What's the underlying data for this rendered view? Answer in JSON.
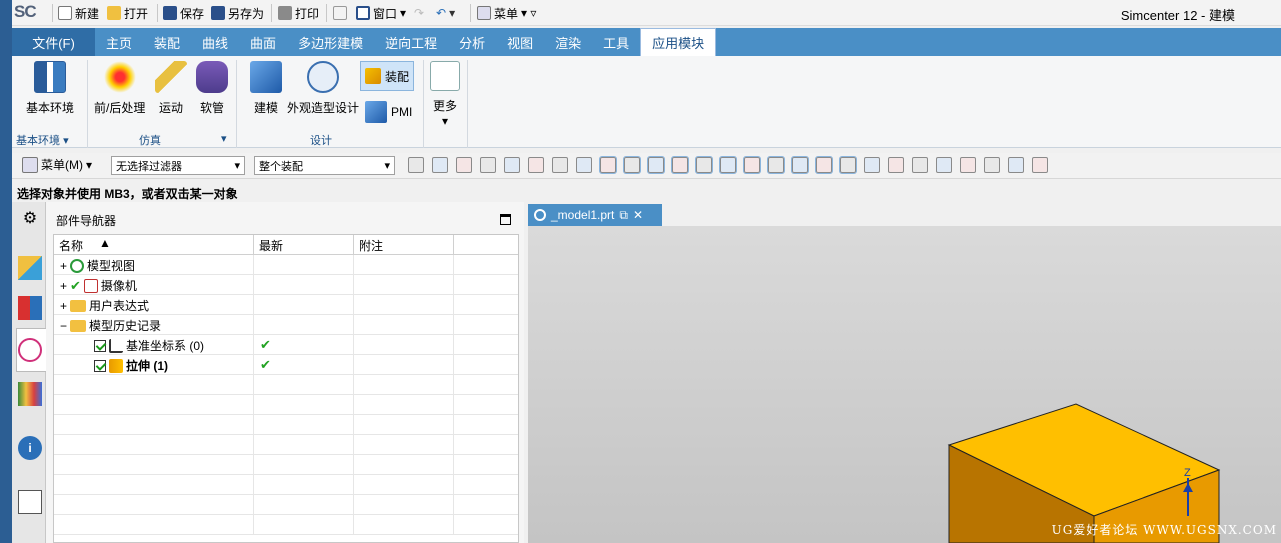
{
  "titlebar": {
    "logo": "SC",
    "new": "新建",
    "open": "打开",
    "save": "保存",
    "save_as": "另存为",
    "print": "打印",
    "window": "窗口",
    "menu": "菜单",
    "app_title": "Simcenter 12 - 建模"
  },
  "tabs": [
    "文件(F)",
    "主页",
    "装配",
    "曲线",
    "曲面",
    "多边形建模",
    "逆向工程",
    "分析",
    "视图",
    "渲染",
    "工具",
    "应用模块"
  ],
  "ribbon": {
    "basic_env": "基本环境",
    "pre_post": "前/后处理",
    "motion": "运动",
    "routing": "软管",
    "modeling": "建模",
    "shape_studio": "外观造型设计",
    "assembly": "装配",
    "pmi": "PMI",
    "more": "更多",
    "group_basic": "基本环境",
    "group_sim": "仿真",
    "group_design": "设计"
  },
  "toolbar": {
    "menu": "菜单(M)",
    "filter": "无选择过滤器",
    "scope": "整个装配"
  },
  "status": "选择对象并使用 MB3，或者双击某一对象",
  "navigator": {
    "title": "部件导航器",
    "columns": [
      "名称",
      "最新",
      "附注"
    ],
    "rows": {
      "r1": "模型视图",
      "r2": "摄像机",
      "r3": "用户表达式",
      "r4": "模型历史记录",
      "r5": "基准坐标系 (0)",
      "r6": "拉伸 (1)"
    },
    "check": "✔"
  },
  "viewport": {
    "tab": "_model1.prt",
    "axis_label": "Z",
    "watermark": "UG爱好者论坛 WWW.UGSNX.COM"
  },
  "colors": {
    "accent": "#4a8fc6",
    "block_top": "#ffbf00",
    "block_front": "#e89a00"
  }
}
